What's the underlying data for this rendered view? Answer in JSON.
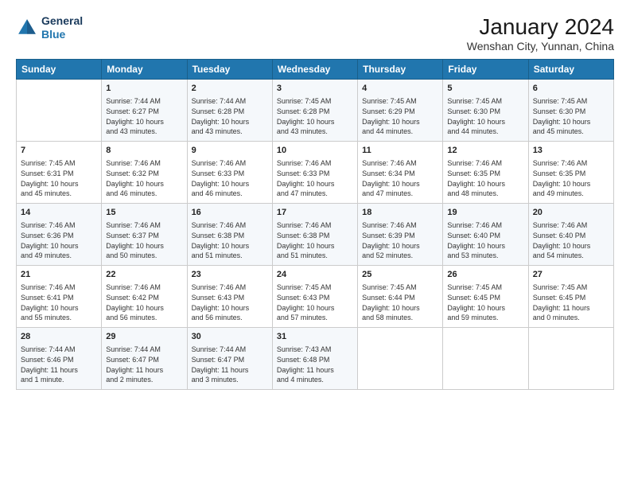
{
  "logo": {
    "line1": "General",
    "line2": "Blue"
  },
  "title": "January 2024",
  "subtitle": "Wenshan City, Yunnan, China",
  "headers": [
    "Sunday",
    "Monday",
    "Tuesday",
    "Wednesday",
    "Thursday",
    "Friday",
    "Saturday"
  ],
  "weeks": [
    [
      {
        "day": "",
        "content": ""
      },
      {
        "day": "1",
        "content": "Sunrise: 7:44 AM\nSunset: 6:27 PM\nDaylight: 10 hours\nand 43 minutes."
      },
      {
        "day": "2",
        "content": "Sunrise: 7:44 AM\nSunset: 6:28 PM\nDaylight: 10 hours\nand 43 minutes."
      },
      {
        "day": "3",
        "content": "Sunrise: 7:45 AM\nSunset: 6:28 PM\nDaylight: 10 hours\nand 43 minutes."
      },
      {
        "day": "4",
        "content": "Sunrise: 7:45 AM\nSunset: 6:29 PM\nDaylight: 10 hours\nand 44 minutes."
      },
      {
        "day": "5",
        "content": "Sunrise: 7:45 AM\nSunset: 6:30 PM\nDaylight: 10 hours\nand 44 minutes."
      },
      {
        "day": "6",
        "content": "Sunrise: 7:45 AM\nSunset: 6:30 PM\nDaylight: 10 hours\nand 45 minutes."
      }
    ],
    [
      {
        "day": "7",
        "content": "Sunrise: 7:45 AM\nSunset: 6:31 PM\nDaylight: 10 hours\nand 45 minutes."
      },
      {
        "day": "8",
        "content": "Sunrise: 7:46 AM\nSunset: 6:32 PM\nDaylight: 10 hours\nand 46 minutes."
      },
      {
        "day": "9",
        "content": "Sunrise: 7:46 AM\nSunset: 6:33 PM\nDaylight: 10 hours\nand 46 minutes."
      },
      {
        "day": "10",
        "content": "Sunrise: 7:46 AM\nSunset: 6:33 PM\nDaylight: 10 hours\nand 47 minutes."
      },
      {
        "day": "11",
        "content": "Sunrise: 7:46 AM\nSunset: 6:34 PM\nDaylight: 10 hours\nand 47 minutes."
      },
      {
        "day": "12",
        "content": "Sunrise: 7:46 AM\nSunset: 6:35 PM\nDaylight: 10 hours\nand 48 minutes."
      },
      {
        "day": "13",
        "content": "Sunrise: 7:46 AM\nSunset: 6:35 PM\nDaylight: 10 hours\nand 49 minutes."
      }
    ],
    [
      {
        "day": "14",
        "content": "Sunrise: 7:46 AM\nSunset: 6:36 PM\nDaylight: 10 hours\nand 49 minutes."
      },
      {
        "day": "15",
        "content": "Sunrise: 7:46 AM\nSunset: 6:37 PM\nDaylight: 10 hours\nand 50 minutes."
      },
      {
        "day": "16",
        "content": "Sunrise: 7:46 AM\nSunset: 6:38 PM\nDaylight: 10 hours\nand 51 minutes."
      },
      {
        "day": "17",
        "content": "Sunrise: 7:46 AM\nSunset: 6:38 PM\nDaylight: 10 hours\nand 51 minutes."
      },
      {
        "day": "18",
        "content": "Sunrise: 7:46 AM\nSunset: 6:39 PM\nDaylight: 10 hours\nand 52 minutes."
      },
      {
        "day": "19",
        "content": "Sunrise: 7:46 AM\nSunset: 6:40 PM\nDaylight: 10 hours\nand 53 minutes."
      },
      {
        "day": "20",
        "content": "Sunrise: 7:46 AM\nSunset: 6:40 PM\nDaylight: 10 hours\nand 54 minutes."
      }
    ],
    [
      {
        "day": "21",
        "content": "Sunrise: 7:46 AM\nSunset: 6:41 PM\nDaylight: 10 hours\nand 55 minutes."
      },
      {
        "day": "22",
        "content": "Sunrise: 7:46 AM\nSunset: 6:42 PM\nDaylight: 10 hours\nand 56 minutes."
      },
      {
        "day": "23",
        "content": "Sunrise: 7:46 AM\nSunset: 6:43 PM\nDaylight: 10 hours\nand 56 minutes."
      },
      {
        "day": "24",
        "content": "Sunrise: 7:45 AM\nSunset: 6:43 PM\nDaylight: 10 hours\nand 57 minutes."
      },
      {
        "day": "25",
        "content": "Sunrise: 7:45 AM\nSunset: 6:44 PM\nDaylight: 10 hours\nand 58 minutes."
      },
      {
        "day": "26",
        "content": "Sunrise: 7:45 AM\nSunset: 6:45 PM\nDaylight: 10 hours\nand 59 minutes."
      },
      {
        "day": "27",
        "content": "Sunrise: 7:45 AM\nSunset: 6:45 PM\nDaylight: 11 hours\nand 0 minutes."
      }
    ],
    [
      {
        "day": "28",
        "content": "Sunrise: 7:44 AM\nSunset: 6:46 PM\nDaylight: 11 hours\nand 1 minute."
      },
      {
        "day": "29",
        "content": "Sunrise: 7:44 AM\nSunset: 6:47 PM\nDaylight: 11 hours\nand 2 minutes."
      },
      {
        "day": "30",
        "content": "Sunrise: 7:44 AM\nSunset: 6:47 PM\nDaylight: 11 hours\nand 3 minutes."
      },
      {
        "day": "31",
        "content": "Sunrise: 7:43 AM\nSunset: 6:48 PM\nDaylight: 11 hours\nand 4 minutes."
      },
      {
        "day": "",
        "content": ""
      },
      {
        "day": "",
        "content": ""
      },
      {
        "day": "",
        "content": ""
      }
    ]
  ]
}
